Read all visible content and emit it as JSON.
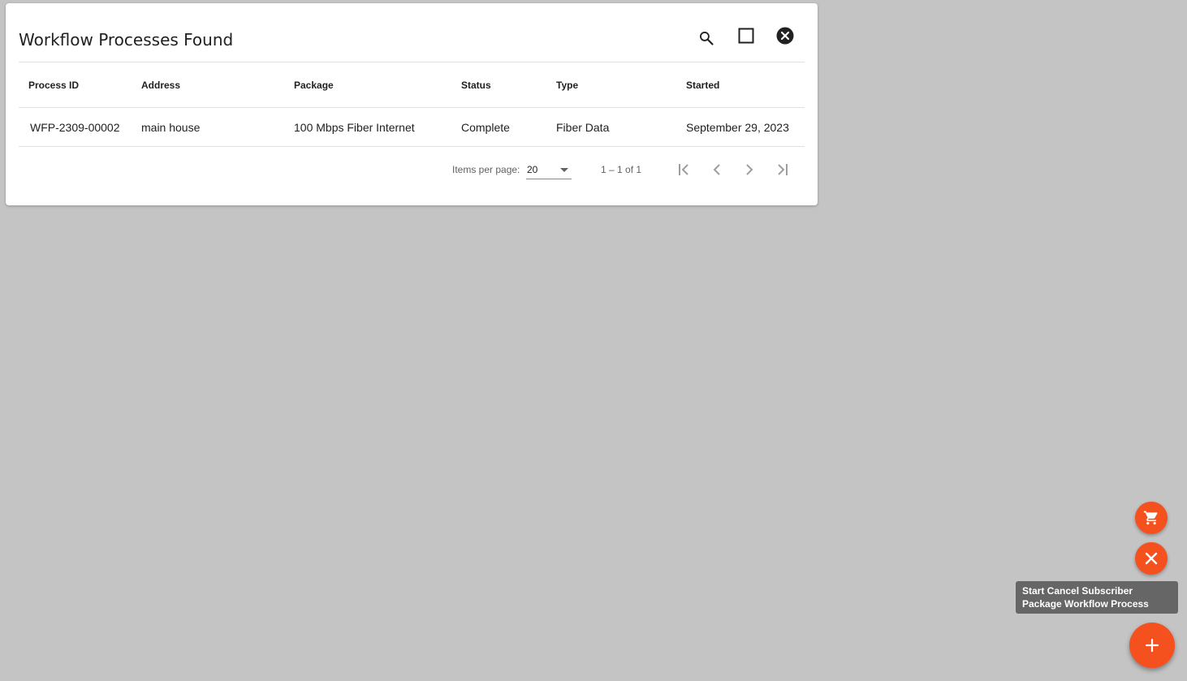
{
  "panel": {
    "title": "Workflow Processes Found",
    "icons": {
      "search": "search-icon",
      "maximize": "maximize-icon",
      "close": "close-circle-icon"
    }
  },
  "table": {
    "columns": [
      "Process ID",
      "Address",
      "Package",
      "Status",
      "Type",
      "Started"
    ],
    "rows": [
      [
        "WFP-2309-00002",
        "main house",
        "100 Mbps Fiber Internet",
        "Complete",
        "Fiber Data",
        "September 29, 2023"
      ]
    ]
  },
  "paginator": {
    "items_per_page_label": "Items per page:",
    "items_per_page_value": "20",
    "range_label": "1 – 1 of 1",
    "icons": [
      "first-page-icon",
      "previous-page-icon",
      "next-page-icon",
      "last-page-icon"
    ]
  },
  "fab": {
    "accent_color": "#f4511e",
    "actions": [
      "cart-icon",
      "close-icon"
    ],
    "main_icon": "plus-icon",
    "tooltip_line1": "Start Cancel Subscriber",
    "tooltip_line2": "Package Workflow Process"
  }
}
